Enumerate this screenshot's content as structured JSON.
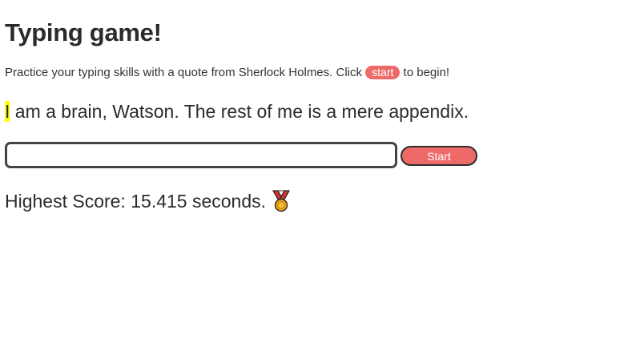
{
  "page": {
    "title": "Typing game!",
    "intro_before": "Practice your typing skills with a quote from Sherlock Holmes. Click ",
    "intro_button": "start",
    "intro_after": " to begin!"
  },
  "quote": {
    "highlighted": "I",
    "rest": " am a brain, Watson. The rest of me is a mere appendix."
  },
  "controls": {
    "input_value": "",
    "start_label": "Start"
  },
  "score": {
    "text": "Highest Score: 15.415 seconds.",
    "icon": "medal-icon"
  },
  "colors": {
    "accent": "#ee6a68",
    "highlight": "#ffff00",
    "text": "#2b2b2b",
    "border": "#444444"
  }
}
